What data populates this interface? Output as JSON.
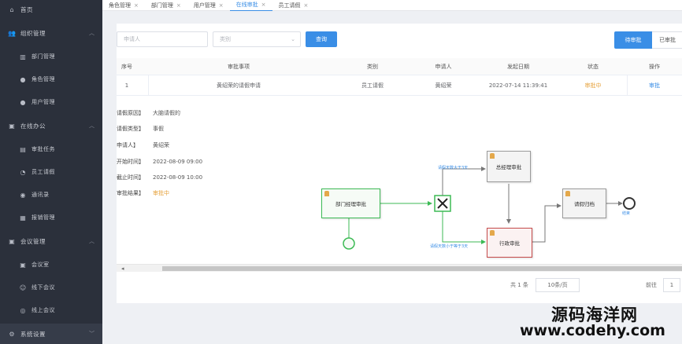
{
  "sidebar": {
    "home": "首页",
    "groups": [
      {
        "label": "组织管理",
        "items": [
          "部门管理",
          "角色管理",
          "用户管理"
        ]
      },
      {
        "label": "在线办公",
        "items": [
          "审批任务",
          "员工请假",
          "通讯录",
          "报销管理"
        ]
      },
      {
        "label": "会议管理",
        "items": [
          "会议室",
          "线下会议",
          "线上会议"
        ]
      }
    ],
    "bottom": "系统设置"
  },
  "tabs": [
    {
      "label": "角色管理",
      "active": false
    },
    {
      "label": "部门管理",
      "active": false
    },
    {
      "label": "用户管理",
      "active": false
    },
    {
      "label": "在线审批",
      "active": true
    },
    {
      "label": "员工请假",
      "active": false
    }
  ],
  "filters": {
    "applicant_placeholder": "申请人",
    "type_placeholder": "类别",
    "search_label": "查询",
    "pending_label": "待审批",
    "approved_label": "已审批"
  },
  "table": {
    "headers": [
      "序号",
      "审批事项",
      "类别",
      "申请人",
      "发起日期",
      "状态",
      "操作"
    ],
    "rows": [
      {
        "index": "1",
        "item": "黄绍荣的请假申请",
        "category": "员工请假",
        "applicant": "黄绍荣",
        "date": "2022-07-14 11:39:41",
        "status": "审批中",
        "action": "审批"
      }
    ]
  },
  "detail": [
    {
      "key": "请假原因】",
      "value": "大脑请假的"
    },
    {
      "key": "请假类型】",
      "value": "事假"
    },
    {
      "key": "申请人】",
      "value": "黄绍荣"
    },
    {
      "key": "开始时间】",
      "value": "2022-08-09 09:00"
    },
    {
      "key": "截止时间】",
      "value": "2022-08-09 10:00"
    },
    {
      "key": "审批结果】",
      "value": "审批中"
    }
  ],
  "diagram": {
    "node_dept": "部门经理审批",
    "node_gm": "总经理审批",
    "node_admin": "行政审批",
    "node_archive": "请假归档",
    "label_top": "请假天数大于3天",
    "label_bottom": "请假天数小于等于3天",
    "end_label": "结束"
  },
  "pager": {
    "total": "共 1 条",
    "size": "10条/页",
    "goto": "前往",
    "page": "1"
  },
  "watermark": {
    "line1": "源码海洋网",
    "line2": "www.codehy.com"
  }
}
